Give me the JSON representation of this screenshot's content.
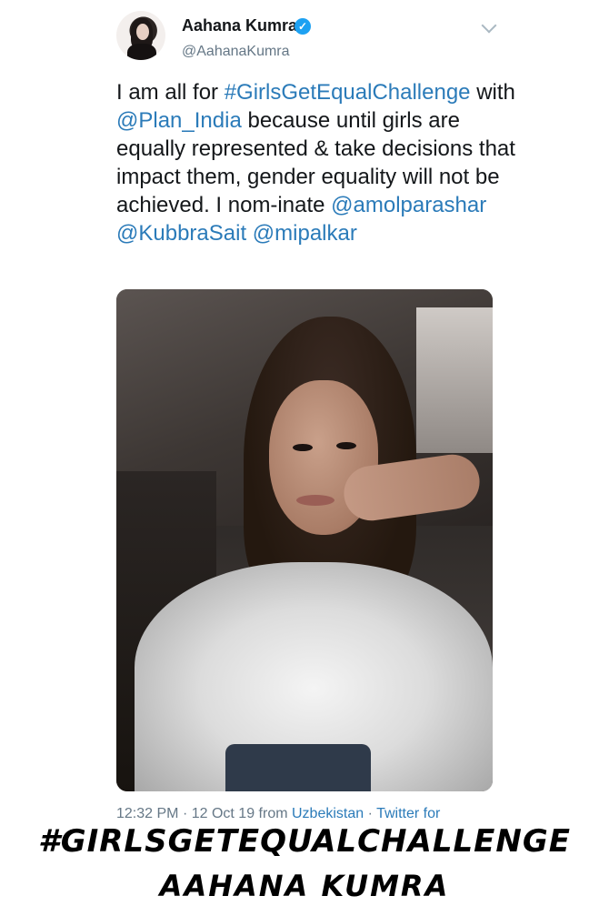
{
  "tweet": {
    "display_name": "Aahana Kumra",
    "handle": "@AahanaKumra",
    "verified_icon": "verified-badge-icon",
    "menu_icon": "chevron-down-icon",
    "text_parts": [
      {
        "text": "I am all for ",
        "link": false
      },
      {
        "text": "#GirlsGetEqualChallenge",
        "link": true
      },
      {
        "text": " with ",
        "link": false
      },
      {
        "text": "@Plan_India",
        "link": true
      },
      {
        "text": " because until girls are equally represented & take decisions that impact them, gender equality will not be achieved. I nom-inate ",
        "link": false
      },
      {
        "text": "@amolparashar",
        "link": true
      },
      {
        "text": " ",
        "link": false
      },
      {
        "text": "@KubbraSait",
        "link": true
      },
      {
        "text": " ",
        "link": false
      },
      {
        "text": "@mipalkar",
        "link": true
      }
    ],
    "time": "12:32 PM",
    "date": "12 Oct 19",
    "from_label": "from",
    "location": "Uzbekistan",
    "source": "Twitter for"
  },
  "captions": {
    "hashtag": "#GIRLSGETEQUALCHALLENGE",
    "name": "AAHANA KUMRA"
  },
  "colors": {
    "link": "#2b7bb9",
    "verified": "#1da1f2",
    "secondary_text": "#657786"
  }
}
